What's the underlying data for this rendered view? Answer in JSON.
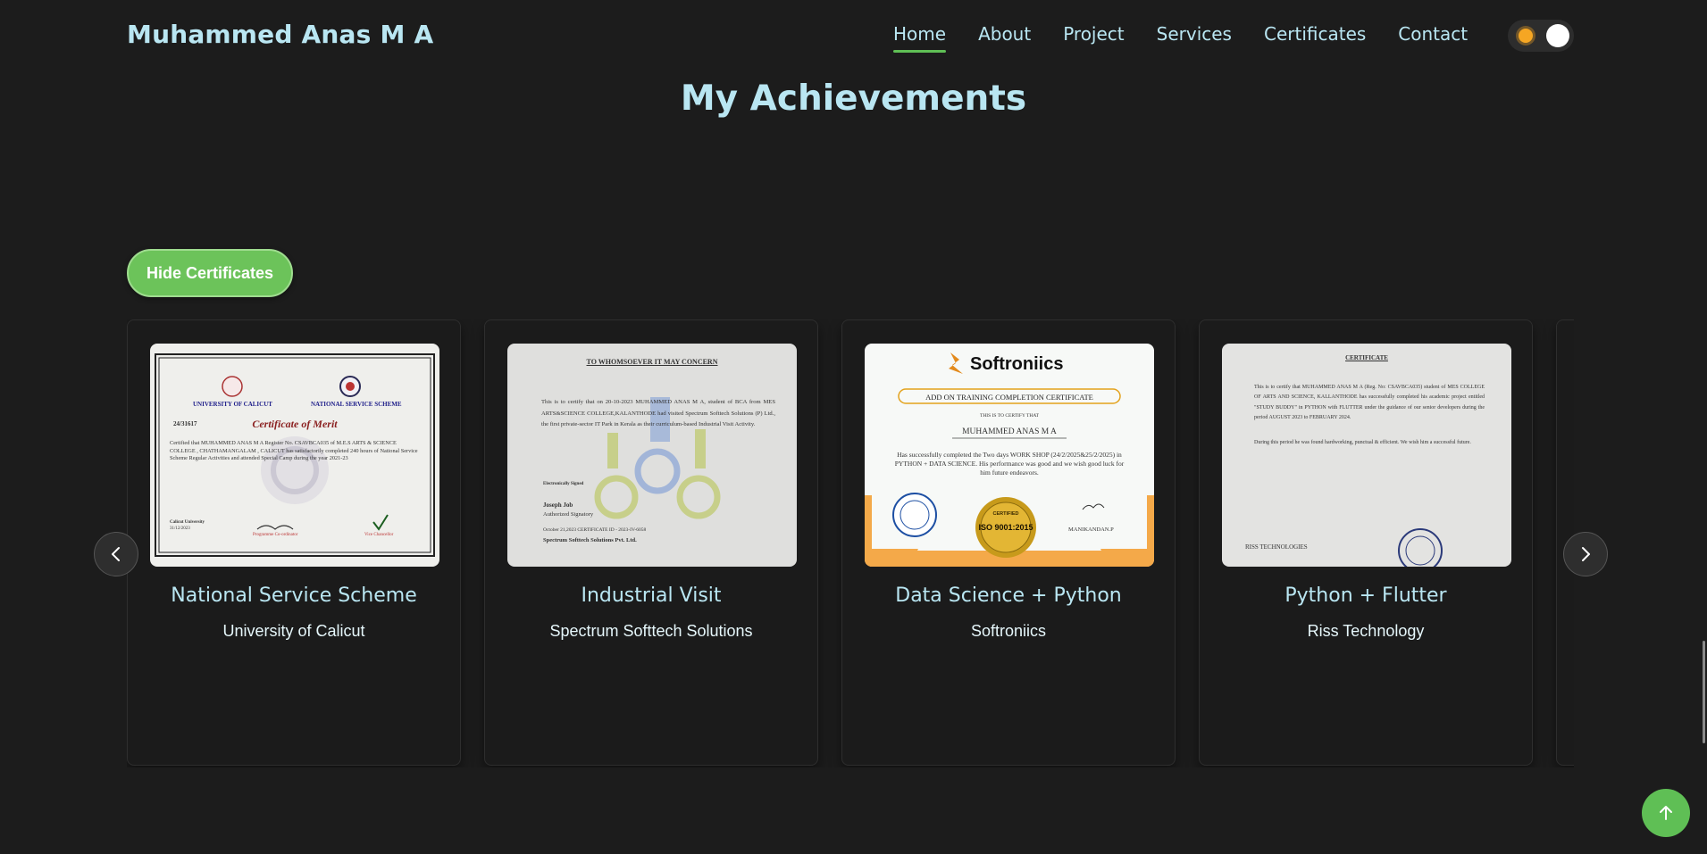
{
  "header": {
    "brand": "Muhammed Anas M A",
    "nav": [
      {
        "label": "Home",
        "active": true
      },
      {
        "label": "About",
        "active": false
      },
      {
        "label": "Project",
        "active": false
      },
      {
        "label": "Services",
        "active": false
      },
      {
        "label": "Certificates",
        "active": false
      },
      {
        "label": "Contact",
        "active": false
      }
    ]
  },
  "section": {
    "title": "My Achievements",
    "hide_button": "Hide Certificates"
  },
  "cards": [
    {
      "title": "National Service Scheme",
      "issuer": "University of Calicut",
      "cert": {
        "top_left": "UNIVERSITY OF CALICUT",
        "top_right": "NATIONAL SERVICE SCHEME",
        "number": "24/31617",
        "heading": "Certificate of Merit",
        "body": "Certified that MUHAMMED ANAS M A Register No. CSAVBCA035 of M.E.S ARTS & SCIENCE COLLEGE , CHATHAMANGALAM , CALICUT has satisfactorily completed 240 hours of National Service Scheme Regular Activities and attended Special Camp during the year 2021-23",
        "left_sign": "Calicut University",
        "date": "31/12/2023",
        "mid_sign": "Programme Co-ordinator",
        "right_sign": "Vice Chancellor"
      }
    },
    {
      "title": "Industrial Visit",
      "issuer": "Spectrum Softtech Solutions",
      "cert": {
        "heading": "TO WHOMSOEVER IT MAY CONCERN",
        "body": "This is to certify that on 20-10-2023 MUHAMMED ANAS M A, student of BCA from MES ARTS&SCIENCE COLLEGE,KALANTHODE had visited Spectrum Softtech Solutions (P) Ltd., the first private-sector IT Park in Kerala as their curriculum-based Industrial Visit Activity.",
        "signed": "Electronically Signed",
        "name": "Joseph Job",
        "role": "Authorized Signatory",
        "cert_id": "October 21,2023 CERTIFICATE ID - 2023-IV-6058",
        "company": "Spectrum Softtech Solutions Pvt. Ltd."
      }
    },
    {
      "title": "Data Science + Python",
      "issuer": "Softroniics",
      "cert": {
        "logo": "Softroniics",
        "banner": "ADD ON TRAINING COMPLETION CERTIFICATE",
        "certify": "THIS IS TO CERTIFY THAT",
        "name": "MUHAMMED ANAS M A",
        "body": "Has successfully completed the Two days WORK SHOP (24/2/2025&25/2/2025) in PYTHON + DATA SCIENCE. His performance was good and we wish good luck for him future endeavors.",
        "iso": "ISO 9001:2015",
        "iso_top": "CERTIFIED",
        "signer": "MANIKANDAN.P"
      }
    },
    {
      "title": "Python + Flutter",
      "issuer": "Riss Technology",
      "cert": {
        "heading": "CERTIFICATE",
        "body": "This is to certify that MUHAMMED ANAS M A (Reg. No: CSAVBCA035) student of MES COLLEGE OF ARTS AND SCIENCE, KALLANTHODE has successfully completed his academic project entitled \"STUDY BUDDY\" in PYTHON with FLUTTER under the guidance of our senior developers during the period AUGUST 2023 to FEBRUARY 2024.",
        "body2": "During this period he was found hardworking, punctual & efficient. We wish him a successful future.",
        "footer": "RISS TECHNOLOGIES"
      }
    }
  ],
  "icons": {
    "theme_toggle": "sun-icon",
    "prev": "chevron-left-icon",
    "next": "chevron-right-icon",
    "scroll_top": "arrow-up-icon"
  },
  "colors": {
    "background": "#1c1c1c",
    "accent_text": "#b9e6f2",
    "green": "#6cc35a"
  }
}
